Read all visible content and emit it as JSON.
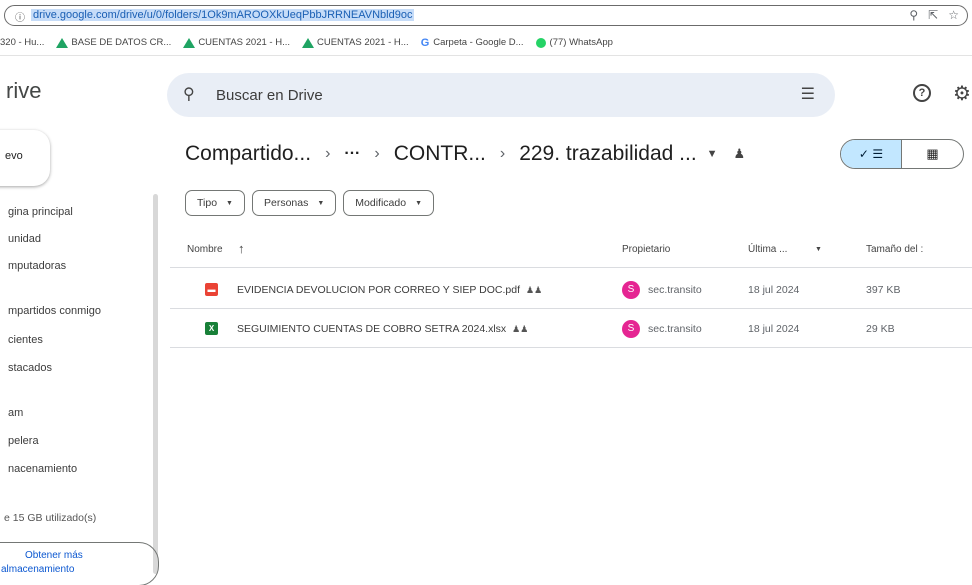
{
  "browser": {
    "url": "drive.google.com/drive/u/0/folders/1Ok9mAROOXkUeqPbbJRRNEAVNbld9oc",
    "bookmarks": [
      {
        "label": "320 - Hu...",
        "icon": "none"
      },
      {
        "label": "BASE DE DATOS CR...",
        "icon": "drive-icon"
      },
      {
        "label": "CUENTAS 2021 - H...",
        "icon": "drive-icon"
      },
      {
        "label": "CUENTAS 2021 - H...",
        "icon": "drive-icon"
      },
      {
        "label": "Carpeta - Google D...",
        "icon": "google-icon"
      },
      {
        "label": "(77) WhatsApp",
        "icon": "whatsapp-icon"
      }
    ]
  },
  "header": {
    "logo_text": "rive",
    "search_placeholder": "Buscar en Drive"
  },
  "sidebar": {
    "new_label": "evo",
    "items": [
      "gina principal",
      "unidad",
      "mputadoras",
      "mpartidos conmigo",
      "cientes",
      "stacados",
      "am",
      "pelera",
      "nacenamiento"
    ],
    "storage_text": "e 15 GB utilizado(s)",
    "more_storage_line1": "Obtener más",
    "more_storage_line2": "almacenamiento"
  },
  "breadcrumb": {
    "root": "Compartido...",
    "ellipsis": "···",
    "middle": "CONTR...",
    "current": "229. trazabilidad ..."
  },
  "filters": [
    "Tipo",
    "Personas",
    "Modificado"
  ],
  "table": {
    "headers": {
      "name": "Nombre",
      "owner": "Propietario",
      "modified": "Última ...",
      "size": "Tamaño del :"
    },
    "rows": [
      {
        "name": "EVIDENCIA DEVOLUCION POR CORREO Y SIEP DOC.pdf",
        "type": "pdf",
        "owner": "sec.transito",
        "owner_initial": "S",
        "modified": "18 jul 2024",
        "size": "397 KB"
      },
      {
        "name": "SEGUIMIENTO CUENTAS DE COBRO SETRA 2024.xlsx",
        "type": "xlsx",
        "owner": "sec.transito",
        "owner_initial": "S",
        "modified": "18 jul 2024",
        "size": "29 KB"
      }
    ]
  },
  "colors": {
    "pdf": "#ea4335",
    "xlsx": "#188038",
    "avatar": "#e52592",
    "selected_view": "#c2e7ff",
    "search_bg": "#e9eef6"
  }
}
